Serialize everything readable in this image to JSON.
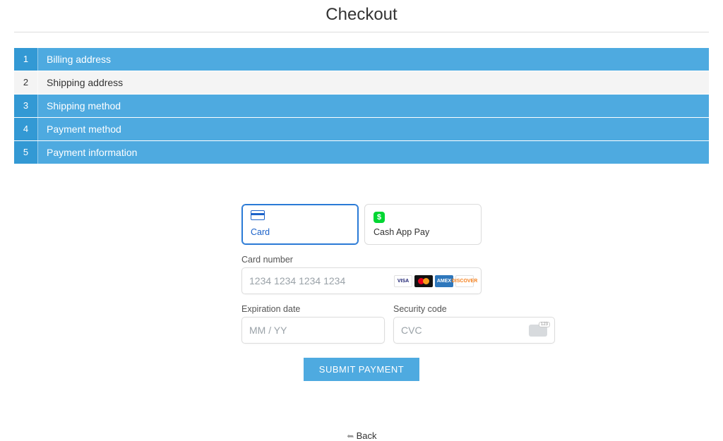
{
  "page_title": "Checkout",
  "steps": [
    {
      "num": "1",
      "label": "Billing address",
      "active": false
    },
    {
      "num": "2",
      "label": "Shipping address",
      "active": true
    },
    {
      "num": "3",
      "label": "Shipping method",
      "active": false
    },
    {
      "num": "4",
      "label": "Payment method",
      "active": false
    },
    {
      "num": "5",
      "label": "Payment information",
      "active": false
    }
  ],
  "payment": {
    "tabs": {
      "card": {
        "label": "Card",
        "selected": true
      },
      "cashapp": {
        "label": "Cash App Pay",
        "selected": false
      }
    },
    "card_number": {
      "label": "Card number",
      "placeholder": "1234 1234 1234 1234",
      "value": "",
      "logos": {
        "visa": "VISA",
        "amex": "AMEX",
        "discover": "DISCOVER"
      }
    },
    "expiration": {
      "label": "Expiration date",
      "placeholder": "MM / YY",
      "value": ""
    },
    "cvc": {
      "label": "Security code",
      "placeholder": "CVC",
      "value": ""
    },
    "submit_label": "SUBMIT PAYMENT"
  },
  "back_label": "Back",
  "cashapp_glyph": "$"
}
